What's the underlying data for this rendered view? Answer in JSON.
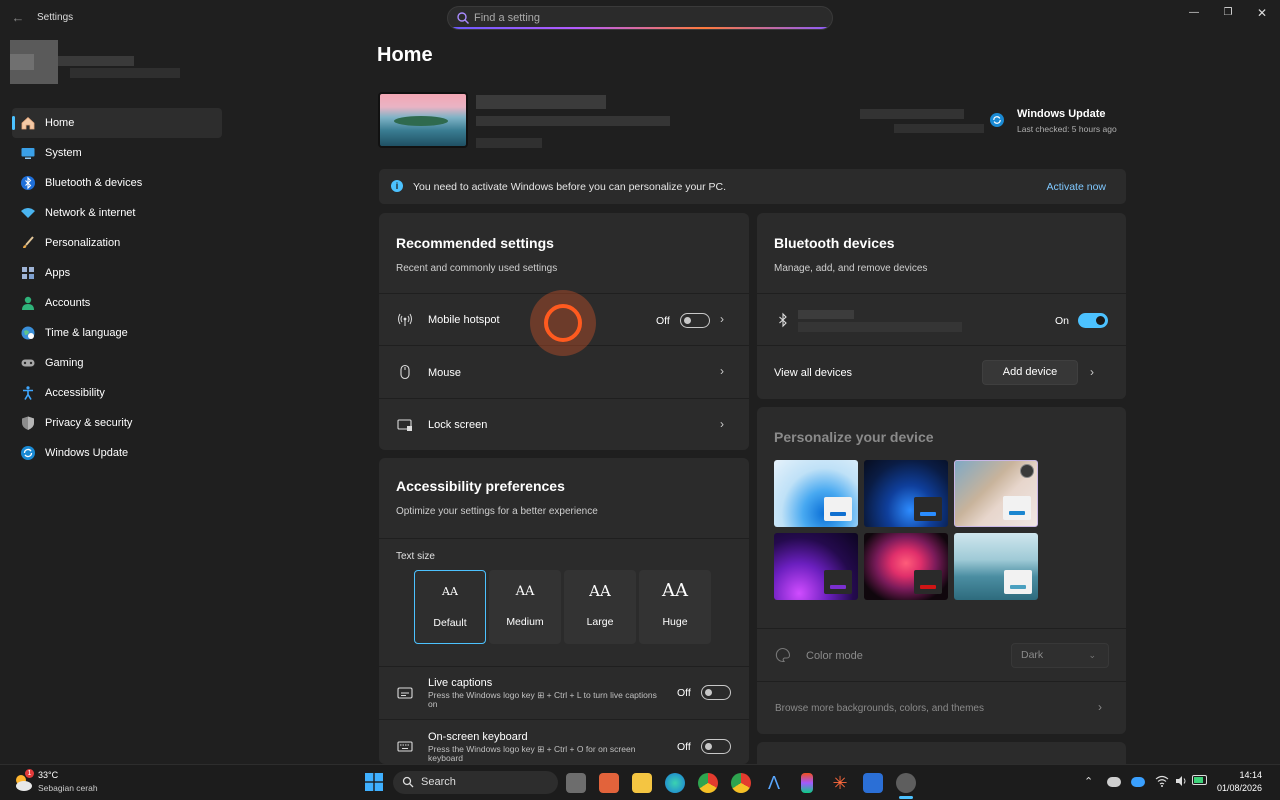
{
  "window": {
    "title": "Settings",
    "search_placeholder": "Find a setting",
    "controls": [
      "minimize",
      "maximize",
      "close"
    ]
  },
  "nav": {
    "items": [
      {
        "label": "Home",
        "icon": "home-icon",
        "active": true
      },
      {
        "label": "System",
        "icon": "system-icon"
      },
      {
        "label": "Bluetooth & devices",
        "icon": "bluetooth-icon"
      },
      {
        "label": "Network & internet",
        "icon": "wifi-icon"
      },
      {
        "label": "Personalization",
        "icon": "brush-icon"
      },
      {
        "label": "Apps",
        "icon": "apps-icon"
      },
      {
        "label": "Accounts",
        "icon": "accounts-icon"
      },
      {
        "label": "Time & language",
        "icon": "globe-icon"
      },
      {
        "label": "Gaming",
        "icon": "gamepad-icon"
      },
      {
        "label": "Accessibility",
        "icon": "accessibility-icon"
      },
      {
        "label": "Privacy & security",
        "icon": "shield-icon"
      },
      {
        "label": "Windows Update",
        "icon": "update-icon"
      }
    ]
  },
  "main": {
    "title": "Home",
    "windows_update": {
      "title": "Windows Update",
      "subtitle": "Last checked: 5 hours ago"
    },
    "activation": {
      "message": "You need to activate Windows before you can personalize your PC.",
      "link": "Activate now"
    },
    "recommended": {
      "title": "Recommended settings",
      "subtitle": "Recent and commonly used settings",
      "rows": [
        {
          "label": "Mobile hotspot",
          "state": "Off"
        },
        {
          "label": "Mouse"
        },
        {
          "label": "Lock screen"
        }
      ]
    },
    "accessibility": {
      "title": "Accessibility preferences",
      "subtitle": "Optimize your settings for a better experience",
      "text_size_label": "Text size",
      "text_sizes": [
        {
          "label": "Default",
          "glyph": "AA"
        },
        {
          "label": "Medium",
          "glyph": "AA"
        },
        {
          "label": "Large",
          "glyph": "AA"
        },
        {
          "label": "Huge",
          "glyph": "AA"
        }
      ],
      "live_captions": {
        "label": "Live captions",
        "desc": "Press the Windows logo key ⊞ + Ctrl + L to turn live captions on",
        "state": "Off"
      },
      "onscreen_keyboard": {
        "label": "On-screen keyboard",
        "desc": "Press the Windows logo key ⊞ + Ctrl + O for on screen keyboard",
        "state": "Off"
      }
    },
    "bluetooth": {
      "title": "Bluetooth devices",
      "subtitle": "Manage, add, and remove devices",
      "state": "On",
      "view_all": "View all devices",
      "add_device": "Add device"
    },
    "personalize": {
      "title": "Personalize your device",
      "color_mode_label": "Color mode",
      "color_mode_value": "Dark",
      "browse": "Browse more backgrounds, colors, and themes"
    }
  },
  "taskbar": {
    "weather_temp": "33°C",
    "weather_desc": "Sebagian cerah",
    "weather_badge": "1",
    "search_label": "Search",
    "time": "14:14",
    "date": "01/08/2026"
  },
  "colors": {
    "accent": "#4cc2ff",
    "background": "#1f1f1f",
    "card": "#2b2b2b",
    "cursor_highlight": "#ff5a1f"
  }
}
